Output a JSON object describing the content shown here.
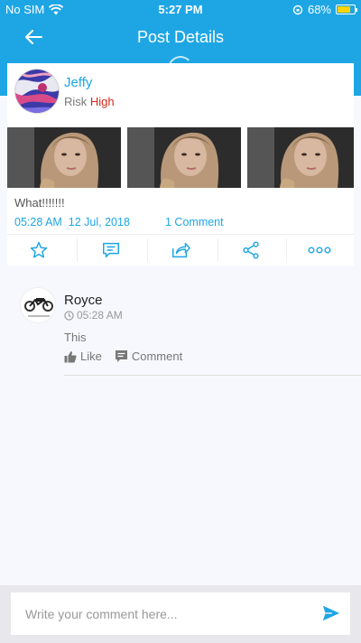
{
  "status_bar": {
    "carrier": "No SIM",
    "time": "5:27 PM",
    "battery": "68%",
    "battery_level": 0.68
  },
  "nav": {
    "title": "Post Details",
    "back_icon": "back-arrow-icon"
  },
  "post": {
    "author": "Jeffy",
    "risk_label": "Risk",
    "risk_level": "High",
    "text": "What!!!!!!!",
    "time": "05:28 AM",
    "date": "12 Jul, 2018",
    "comment_count": "1 Comment",
    "photo_count": 3,
    "actions": [
      "star-icon",
      "chat-icon",
      "share-out-icon",
      "share-icon",
      "more-icon"
    ]
  },
  "comments": [
    {
      "author": "Royce",
      "time": "05:28 AM",
      "text": "This",
      "like_label": "Like",
      "comment_label": "Comment"
    }
  ],
  "composer": {
    "placeholder": "Write your comment here...",
    "send_icon": "send-icon"
  },
  "colors": {
    "primary": "#1ea6e4",
    "risk_high": "#d8281b",
    "background": "#f7f8fd"
  }
}
